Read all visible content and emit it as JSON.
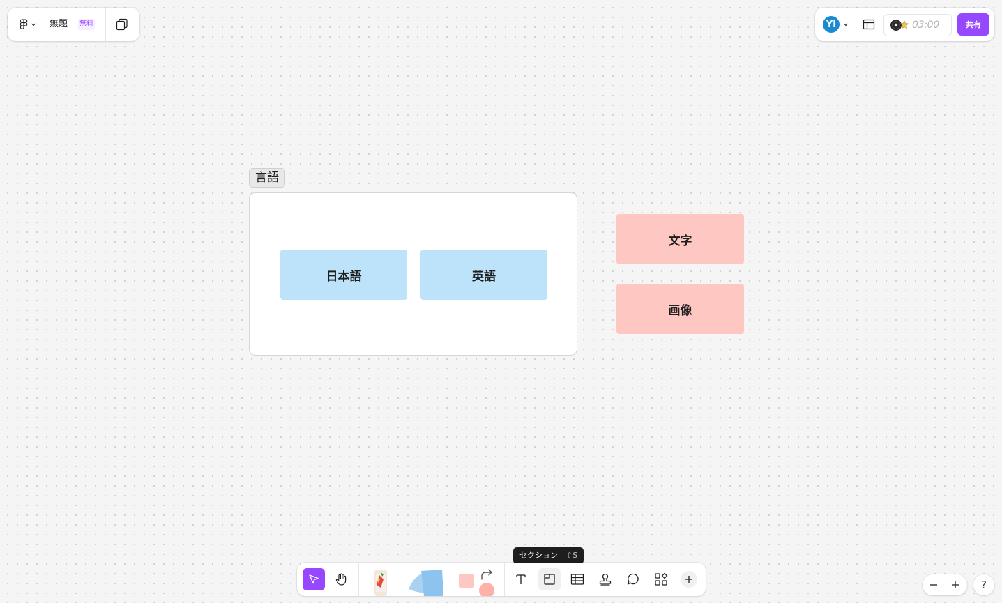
{
  "header": {
    "app_menu_icon": "figma-logo-icon",
    "file_title": "無題",
    "plan_badge": "無料",
    "pages_icon": "pages-icon"
  },
  "top_right": {
    "avatar_initials": "YI",
    "layout_icon": "panel-layout-icon",
    "timer_icons": [
      "music-disc-icon",
      "sparkle-icon"
    ],
    "timer_value": "03:00",
    "share_label": "共有"
  },
  "canvas": {
    "section": {
      "label": "言語",
      "cards": [
        "日本語",
        "英語"
      ]
    },
    "loose_cards": [
      "文字",
      "画像"
    ],
    "colors": {
      "blue_card": "#bde3fb",
      "pink_card": "#ffc7c2",
      "accent": "#9747ff"
    }
  },
  "toolbar": {
    "tools": [
      {
        "name": "move",
        "icon": "cursor-icon",
        "active": true
      },
      {
        "name": "hand",
        "icon": "hand-icon"
      },
      {
        "name": "marker",
        "icon": "marker-icon"
      },
      {
        "name": "sticky",
        "icon": "sticky-note-icon"
      },
      {
        "name": "shape",
        "icon": "shape-icon"
      },
      {
        "name": "connector",
        "icon": "connector-icon"
      },
      {
        "name": "text",
        "icon": "text-icon"
      },
      {
        "name": "section",
        "icon": "section-icon",
        "hover": true
      },
      {
        "name": "table",
        "icon": "table-icon"
      },
      {
        "name": "stamp",
        "icon": "stamp-icon"
      },
      {
        "name": "comment",
        "icon": "comment-icon"
      },
      {
        "name": "widgets",
        "icon": "widgets-icon"
      },
      {
        "name": "more",
        "icon": "plus-icon"
      }
    ],
    "tooltip": {
      "label": "セクション",
      "shortcut": "⇧S"
    }
  },
  "zoom": {
    "out_icon": "minus-icon",
    "in_icon": "plus-icon"
  },
  "help_label": "?"
}
